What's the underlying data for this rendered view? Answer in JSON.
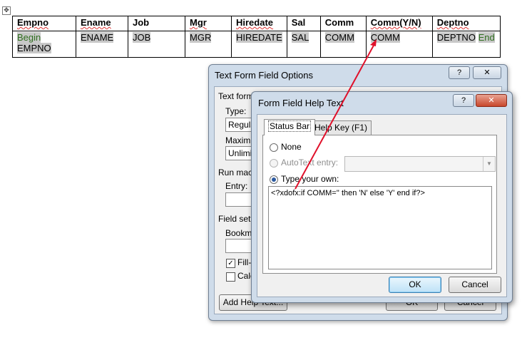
{
  "table": {
    "headers": [
      "Empno",
      "Ename",
      "Job",
      "Mgr",
      "Hiredate",
      "Sal",
      "Comm",
      "Comm(Y/N)",
      "Deptno"
    ],
    "row": {
      "empno_begin": "Begin",
      "empno": "EMPNO",
      "ename": "ENAME",
      "job": "JOB",
      "mgr": "MGR",
      "hiredate": "HIREDATE",
      "sal": "SAL",
      "comm": "COMM",
      "comm_yn": "COMM",
      "deptno": "DEPTNO",
      "deptno_end": "End"
    }
  },
  "options_dialog": {
    "title": "Text Form Field Options",
    "section_text_form": "Text form",
    "type_label": "Type:",
    "type_value": "Regula",
    "maximum_label": "Maximum",
    "maximum_value": "Unlimite",
    "run_macro_label": "Run macro",
    "entry_label": "Entry:",
    "field_settings_label": "Field setti",
    "bookmark_label": "Bookma",
    "fill_in_label": "Fill-i",
    "fill_in_checked": true,
    "calculate_label": "Calc",
    "calculate_checked": false,
    "add_help_text_button": "Add Help Text...",
    "ok_button": "OK",
    "cancel_button": "Cancel",
    "help_button": "?",
    "close_button": "✕"
  },
  "help_dialog": {
    "title": "Form Field Help Text",
    "help_button": "?",
    "close_button": "✕",
    "tabs": [
      "Status Bar",
      "Help Key (F1)"
    ],
    "active_tab": "Status Bar",
    "none_label": "None",
    "autotext_label": "AutoText entry:",
    "type_own_label": "Type your own:",
    "selected_option": "Type your own",
    "text_value": "<?xdofx:if COMM='' then 'N' else 'Y' end if?>",
    "ok_button": "OK",
    "cancel_button": "Cancel"
  },
  "colors": {
    "annotation_arrow": "#e0102a",
    "dialog_frame": "#cfdcea",
    "field_shading": "#c8c8c8",
    "begin_end_text": "#2f6e1f"
  }
}
